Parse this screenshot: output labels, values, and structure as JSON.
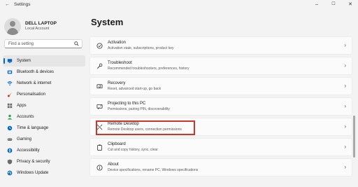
{
  "window": {
    "title": "Settings",
    "controls": [
      "–",
      "☐",
      "✕"
    ]
  },
  "profile": {
    "name": "DELL LAPTOP",
    "account": "Local Account"
  },
  "search": {
    "placeholder": "Find a setting"
  },
  "sidebar": {
    "selected": "System",
    "items": [
      {
        "label": "System",
        "icon": "system-icon",
        "color": "#0067c0"
      },
      {
        "label": "Bluetooth & devices",
        "icon": "bluetooth-icon",
        "color": "#0067c0"
      },
      {
        "label": "Network & internet",
        "icon": "wifi-icon",
        "color": "#0067c0"
      },
      {
        "label": "Personalisation",
        "icon": "brush-icon",
        "color": "#e08a1e"
      },
      {
        "label": "Apps",
        "icon": "apps-icon",
        "color": "#6b6b6b"
      },
      {
        "label": "Accounts",
        "icon": "person-icon",
        "color": "#2fa44f"
      },
      {
        "label": "Time & language",
        "icon": "globe-clock-icon",
        "color": "#0067c0"
      },
      {
        "label": "Gaming",
        "icon": "gamepad-icon",
        "color": "#6b6b6b"
      },
      {
        "label": "Accessibility",
        "icon": "accessibility-icon",
        "color": "#0067c0"
      },
      {
        "label": "Privacy & security",
        "icon": "shield-icon",
        "color": "#6b6b6b"
      },
      {
        "label": "Windows Update",
        "icon": "update-icon",
        "color": "#0067c0"
      }
    ]
  },
  "main": {
    "title": "System",
    "cards": [
      {
        "title": "Activation",
        "subtitle": "Activation state, subscriptions, product key",
        "icon": "check-circle-icon"
      },
      {
        "title": "Troubleshoot",
        "subtitle": "Recommended troubleshooters, preferences, history",
        "icon": "wrench-icon"
      },
      {
        "title": "Recovery",
        "subtitle": "Reset, advanced start-up, go back",
        "icon": "recovery-icon"
      },
      {
        "title": "Projecting to this PC",
        "subtitle": "Permissions, pairing PIN, discoverability",
        "icon": "projector-icon"
      },
      {
        "title": "Remote Desktop",
        "subtitle": "Remote Desktop users, connection permissions",
        "icon": "remote-desktop-icon"
      },
      {
        "title": "Clipboard",
        "subtitle": "Cut and copy history, sync, clear",
        "icon": "clipboard-icon"
      },
      {
        "title": "About",
        "subtitle": "Device specifications, rename PC, Windows specifications",
        "icon": "info-icon"
      }
    ],
    "highlighted_card": "Remote Desktop",
    "highlight_color": "#c8372d"
  }
}
